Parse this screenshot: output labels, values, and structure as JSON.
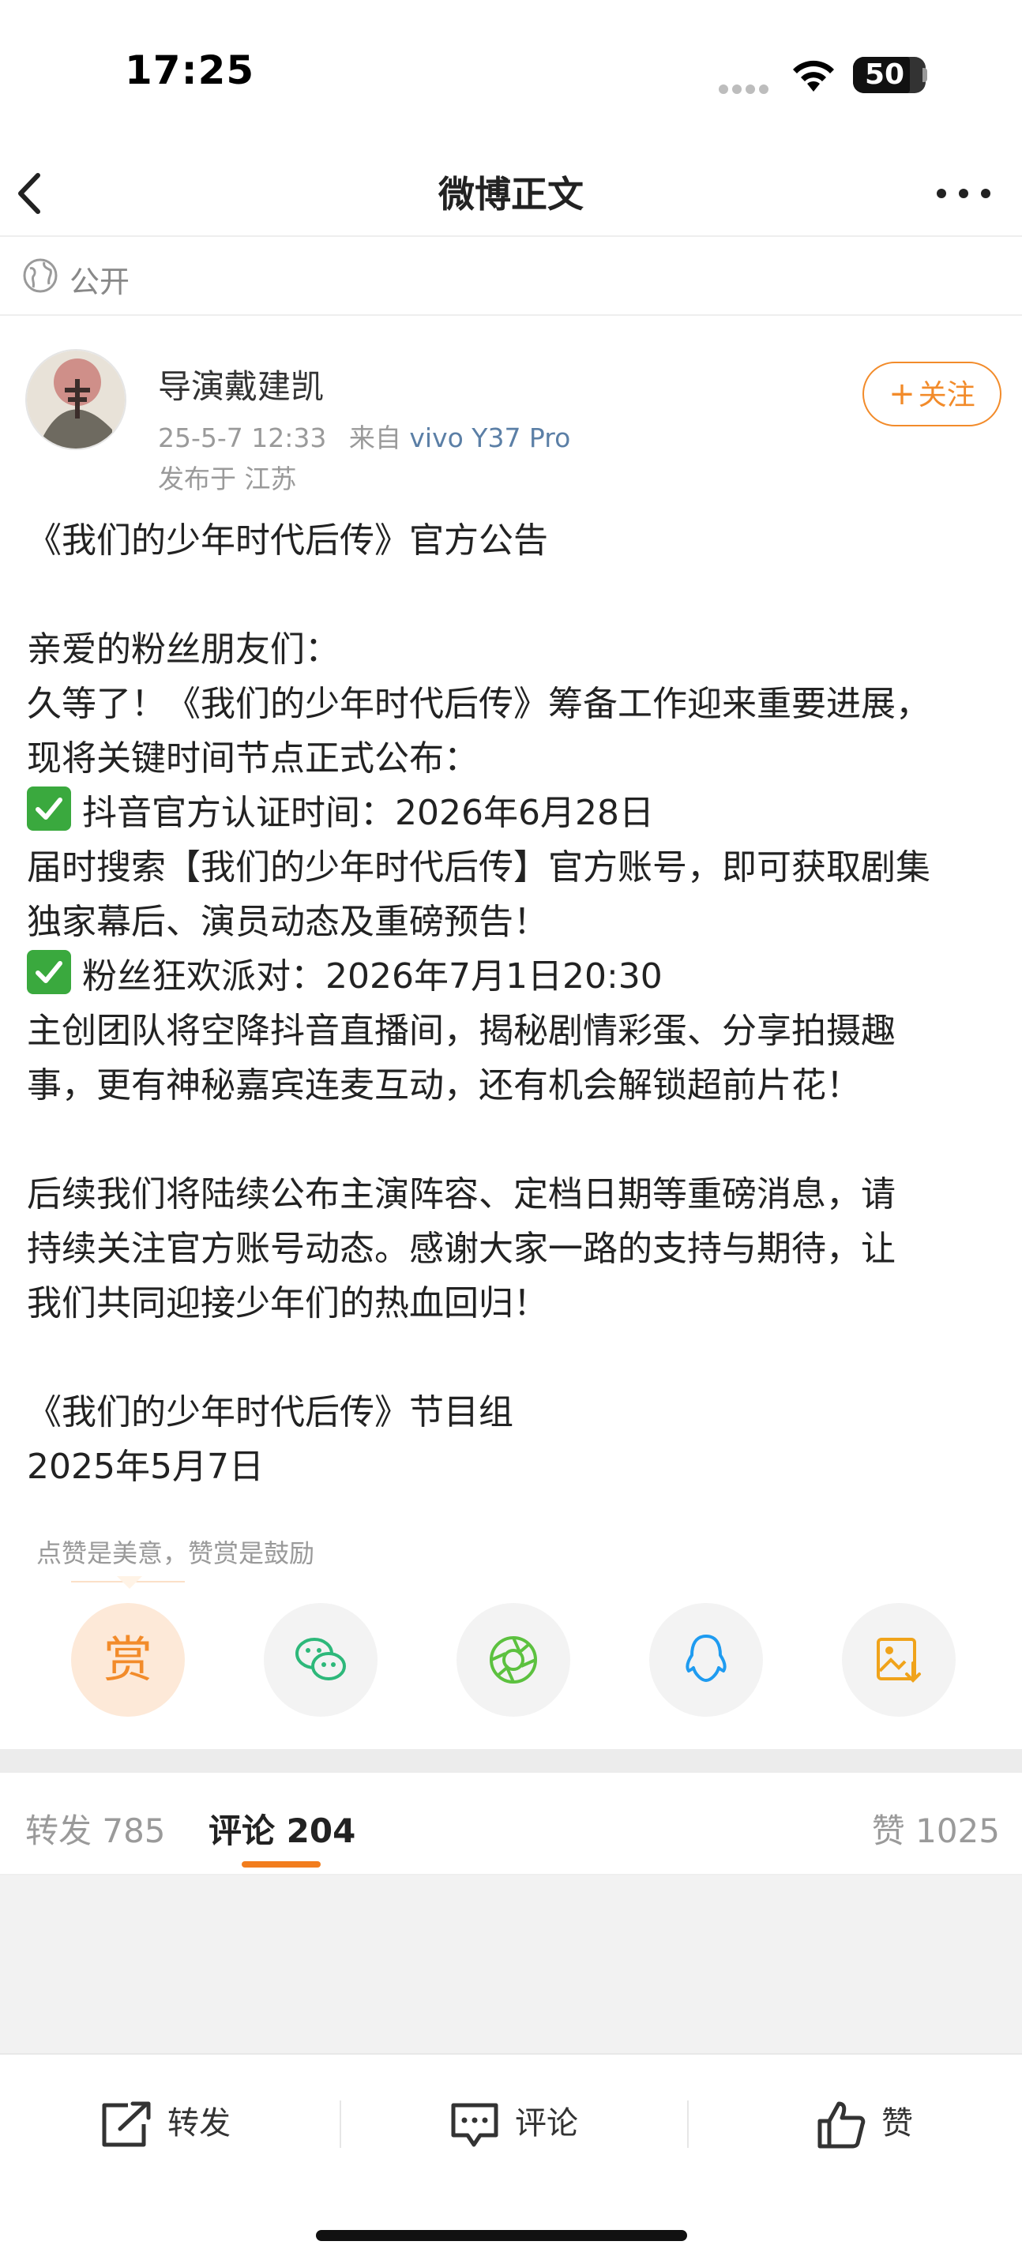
{
  "status_bar": {
    "time": "17:25",
    "battery": "50"
  },
  "nav": {
    "title": "微博正文"
  },
  "visibility": {
    "label": "公开"
  },
  "author": {
    "name": "导演戴建凯",
    "timestamp": "25-5-7 12:33",
    "source_prefix": "来自",
    "device": "vivo Y37 Pro",
    "location": "发布于 江苏",
    "follow_label": "关注"
  },
  "post": {
    "lines": [
      "《我们的少年时代后传》官方公告",
      "",
      "亲爱的粉丝朋友们：",
      "久等了！《我们的少年时代后传》筹备工作迎来重要进展，",
      "现将关键时间节点正式公布：",
      "抖音官方认证时间：2026年6月28日",
      "届时搜索【我们的少年时代后传】官方账号，即可获取剧集",
      "独家幕后、演员动态及重磅预告！",
      "粉丝狂欢派对：2026年7月1日20:30",
      "主创团队将空降抖音直播间，揭秘剧情彩蛋、分享拍摄趣",
      "事，更有神秘嘉宾连麦互动，还有机会解锁超前片花！",
      "",
      "后续我们将陆续公布主演阵容、定档日期等重磅消息，请",
      "持续关注官方账号动态。感谢大家一路的支持与期待，让",
      "我们共同迎接少年们的热血回归！",
      "",
      "《我们的少年时代后传》节目组",
      "2025年5月7日"
    ]
  },
  "reward": {
    "tip": "点赞是美意，赞赏是鼓励",
    "reward_char": "赏"
  },
  "share_icons": [
    "reward-icon",
    "wechat-icon",
    "moments-icon",
    "qq-icon",
    "save-image-icon"
  ],
  "tabs": {
    "repost": "转发 785",
    "comment": "评论 204",
    "like": "赞 1025"
  },
  "bottom_bar": {
    "repost_label": "转发",
    "comment_label": "评论",
    "like_label": "赞"
  },
  "colors": {
    "accent": "#f27d1d",
    "link": "#5b7fa6",
    "check": "#3aa93e"
  }
}
